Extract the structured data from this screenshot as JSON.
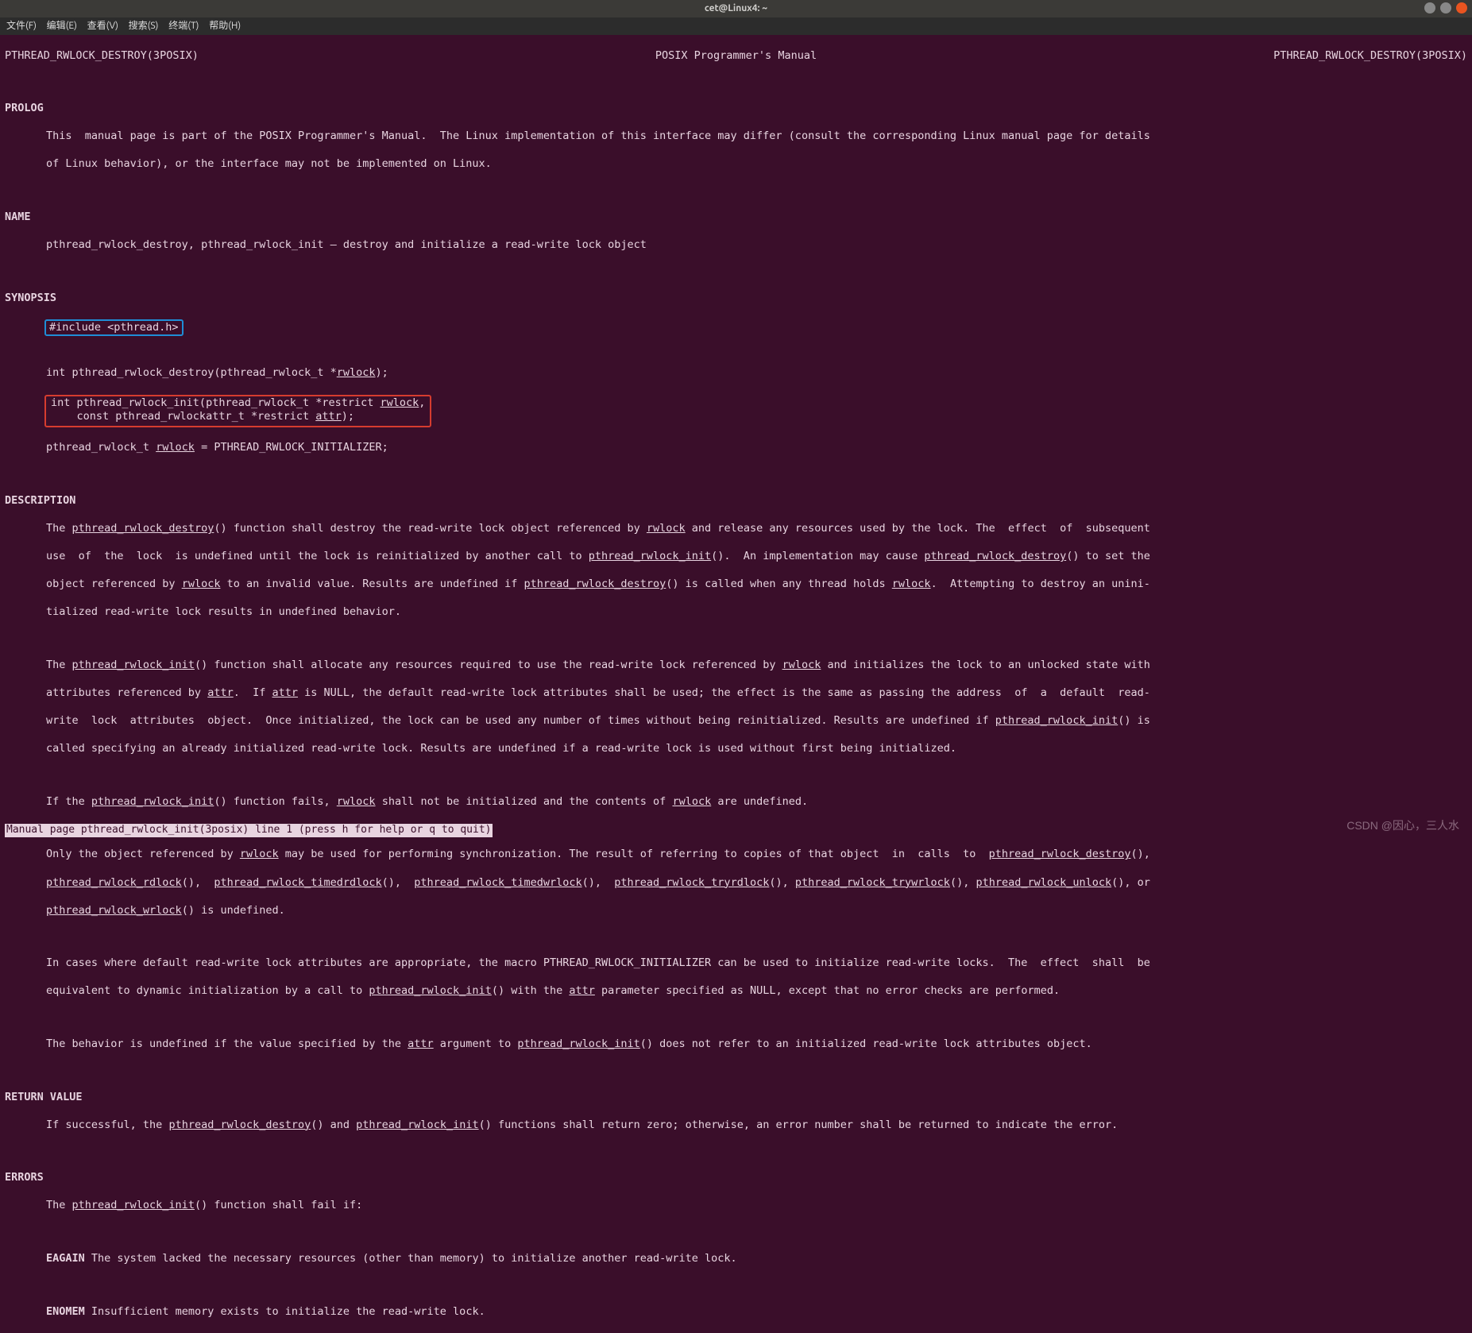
{
  "window": {
    "title": "cet@Linux4: ~"
  },
  "menu": {
    "file": "文件(F)",
    "edit": "编辑(E)",
    "view": "查看(V)",
    "search": "搜索(S)",
    "terminal": "终端(T)",
    "help": "帮助(H)"
  },
  "header": {
    "left": "PTHREAD_RWLOCK_DESTROY(3POSIX)",
    "center": "POSIX Programmer's Manual",
    "right": "PTHREAD_RWLOCK_DESTROY(3POSIX)"
  },
  "sections": {
    "prolog": "PROLOG",
    "prolog_text1": "This  manual page is part of the POSIX Programmer's Manual.  The Linux implementation of this interface may differ (consult the corresponding Linux manual page for details",
    "prolog_text2": "of Linux behavior), or the interface may not be implemented on Linux.",
    "name": "NAME",
    "name_text": "pthread_rwlock_destroy, pthread_rwlock_init — destroy and initialize a read-write lock object",
    "synopsis": "SYNOPSIS",
    "syn_include": "#include <pthread.h>",
    "syn_destroy_pre": "int pthread_rwlock_destroy(pthread_rwlock_t *",
    "syn_destroy_arg": "rwlock",
    "syn_destroy_post": ");",
    "syn_init_l1a": "int pthread_rwlock_init(pthread_rwlock_t *restrict ",
    "syn_init_l1b": "rwlock",
    "syn_init_l1c": ",",
    "syn_init_l2a": "    const pthread_rwlockattr_t *restrict ",
    "syn_init_l2b": "attr",
    "syn_init_l2c": ");",
    "syn_static_a": "pthread_rwlock_t ",
    "syn_static_b": "rwlock",
    "syn_static_c": " = PTHREAD_RWLOCK_INITIALIZER;",
    "description": "DESCRIPTION",
    "d1a": "The ",
    "d1b": "pthread_rwlock_destroy",
    "d1c": "() function shall destroy the read-write lock object referenced by ",
    "d1d": "rwlock",
    "d1e": " and release any resources used by the lock. The  effect  of  subsequent",
    "d2a": "use  of  the  lock  is undefined until the lock is reinitialized by another call to ",
    "d2b": "pthread_rwlock_init",
    "d2c": "().  An implementation may cause ",
    "d2d": "pthread_rwlock_destroy",
    "d2e": "() to set the",
    "d3a": "object referenced by ",
    "d3b": "rwlock",
    "d3c": " to an invalid value. Results are undefined if ",
    "d3d": "pthread_rwlock_destroy",
    "d3e": "() is called when any thread holds ",
    "d3f": "rwlock",
    "d3g": ".  Attempting to destroy an unini‐",
    "d4": "tialized read-write lock results in undefined behavior.",
    "d5a": "The ",
    "d5b": "pthread_rwlock_init",
    "d5c": "() function shall allocate any resources required to use the read-write lock referenced by ",
    "d5d": "rwlock",
    "d5e": " and initializes the lock to an unlocked state with",
    "d6a": "attributes referenced by ",
    "d6b": "attr",
    "d6c": ".  If ",
    "d6d": "attr",
    "d6e": " is NULL, the default read-write lock attributes shall be used; the effect is the same as passing the address  of  a  default  read-",
    "d7a": "write  lock  attributes  object.  Once initialized, the lock can be used any number of times without being reinitialized. Results are undefined if ",
    "d7b": "pthread_rwlock_init",
    "d7c": "() is",
    "d8": "called specifying an already initialized read-write lock. Results are undefined if a read-write lock is used without first being initialized.",
    "d9a": "If the ",
    "d9b": "pthread_rwlock_init",
    "d9c": "() function fails, ",
    "d9d": "rwlock",
    "d9e": " shall not be initialized and the contents of ",
    "d9f": "rwlock",
    "d9g": " are undefined.",
    "d10a": "Only the object referenced by ",
    "d10b": "rwlock",
    "d10c": " may be used for performing synchronization. The result of referring to copies of that object  in  calls  to  ",
    "d10d": "pthread_rwlock_destroy",
    "d10e": "(),",
    "d11a": "pthread_rwlock_rdlock",
    "d11b": "(),  ",
    "d11c": "pthread_rwlock_timedrdlock",
    "d11d": "(),  ",
    "d11e": "pthread_rwlock_timedwrlock",
    "d11f": "(),  ",
    "d11g": "pthread_rwlock_tryrdlock",
    "d11h": "(), ",
    "d11i": "pthread_rwlock_trywrlock",
    "d11j": "(), ",
    "d11k": "pthread_rwlock_unlock",
    "d11l": "(), or",
    "d12a": "pthread_rwlock_wrlock",
    "d12b": "() is undefined.",
    "d13": "In cases where default read-write lock attributes are appropriate, the macro PTHREAD_RWLOCK_INITIALIZER can be used to initialize read-write locks.  The  effect  shall  be",
    "d14a": "equivalent to dynamic initialization by a call to ",
    "d14b": "pthread_rwlock_init",
    "d14c": "() with the ",
    "d14d": "attr",
    "d14e": " parameter specified as NULL, except that no error checks are performed.",
    "d15a": "The behavior is undefined if the value specified by the ",
    "d15b": "attr",
    "d15c": " argument to ",
    "d15d": "pthread_rwlock_init",
    "d15e": "() does not refer to an initialized read-write lock attributes object.",
    "return_value": "RETURN VALUE",
    "rv1a": "If successful, the ",
    "rv1b": "pthread_rwlock_destroy",
    "rv1c": "() and ",
    "rv1d": "pthread_rwlock_init",
    "rv1e": "() functions shall return zero; otherwise, an error number shall be returned to indicate the error.",
    "errors": "ERRORS",
    "e1a": "The ",
    "e1b": "pthread_rwlock_init",
    "e1c": "() function shall fail if:",
    "eagain": "EAGAIN",
    "eagain_text": " The system lacked the necessary resources (other than memory) to initialize another read-write lock.",
    "enomem": "ENOMEM",
    "enomem_text": " Insufficient memory exists to initialize the read-write lock."
  },
  "statusbar": " Manual page pthread_rwlock_init(3posix) line 1 (press h for help or q to quit)",
  "watermark": "CSDN @因心，三人水"
}
